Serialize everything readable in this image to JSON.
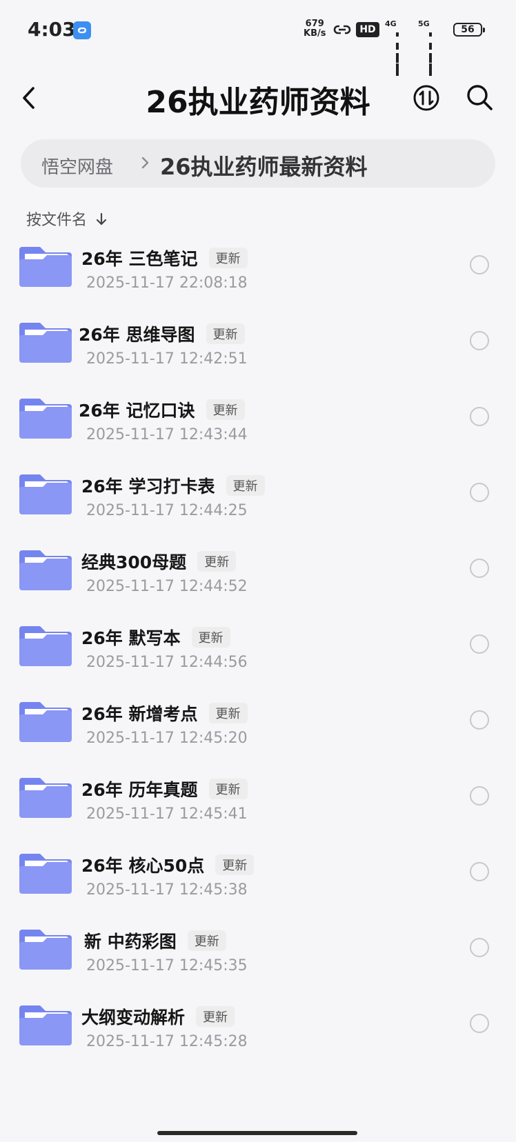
{
  "status_bar": {
    "time": "4:03",
    "net_speed_value": "679",
    "net_speed_unit": "KB/s",
    "hd_label": "HD",
    "sim1_label": "4G",
    "sim2_label": "5G",
    "battery_level": "56"
  },
  "header": {
    "title": "26执业药师资料",
    "back_icon": "back-arrow-icon",
    "sort_icon": "sort-toggle-icon",
    "search_icon": "search-icon"
  },
  "breadcrumb": {
    "root": "悟空网盘",
    "current": "26执业药师最新资料"
  },
  "sort_label": "按文件名",
  "update_tag": "更新",
  "files": [
    {
      "name": "26年 三色笔记",
      "date": "2025-11-17 22:08:18"
    },
    {
      "name": "26年 思维导图",
      "date": "2025-11-17 12:42:51"
    },
    {
      "name": "26年 记忆口诀",
      "date": "2025-11-17 12:43:44"
    },
    {
      "name": "26年 学习打卡表",
      "date": "2025-11-17 12:44:25"
    },
    {
      "name": "经典300母题",
      "date": "2025-11-17 12:44:52"
    },
    {
      "name": "26年 默写本",
      "date": "2025-11-17 12:44:56"
    },
    {
      "name": "26年 新增考点",
      "date": "2025-11-17 12:45:20"
    },
    {
      "name": "26年 历年真题",
      "date": "2025-11-17 12:45:41"
    },
    {
      "name": "26年 核心50点",
      "date": "2025-11-17 12:45:38"
    },
    {
      "name": "新 中药彩图",
      "date": "2025-11-17 12:45:35"
    },
    {
      "name": "大纲变动解析",
      "date": "2025-11-17 12:45:28"
    }
  ],
  "colors": {
    "folder_body": "#8a97f5",
    "folder_tab": "#7585f0",
    "folder_paper": "#ffffff",
    "background": "#f6f6f8"
  }
}
